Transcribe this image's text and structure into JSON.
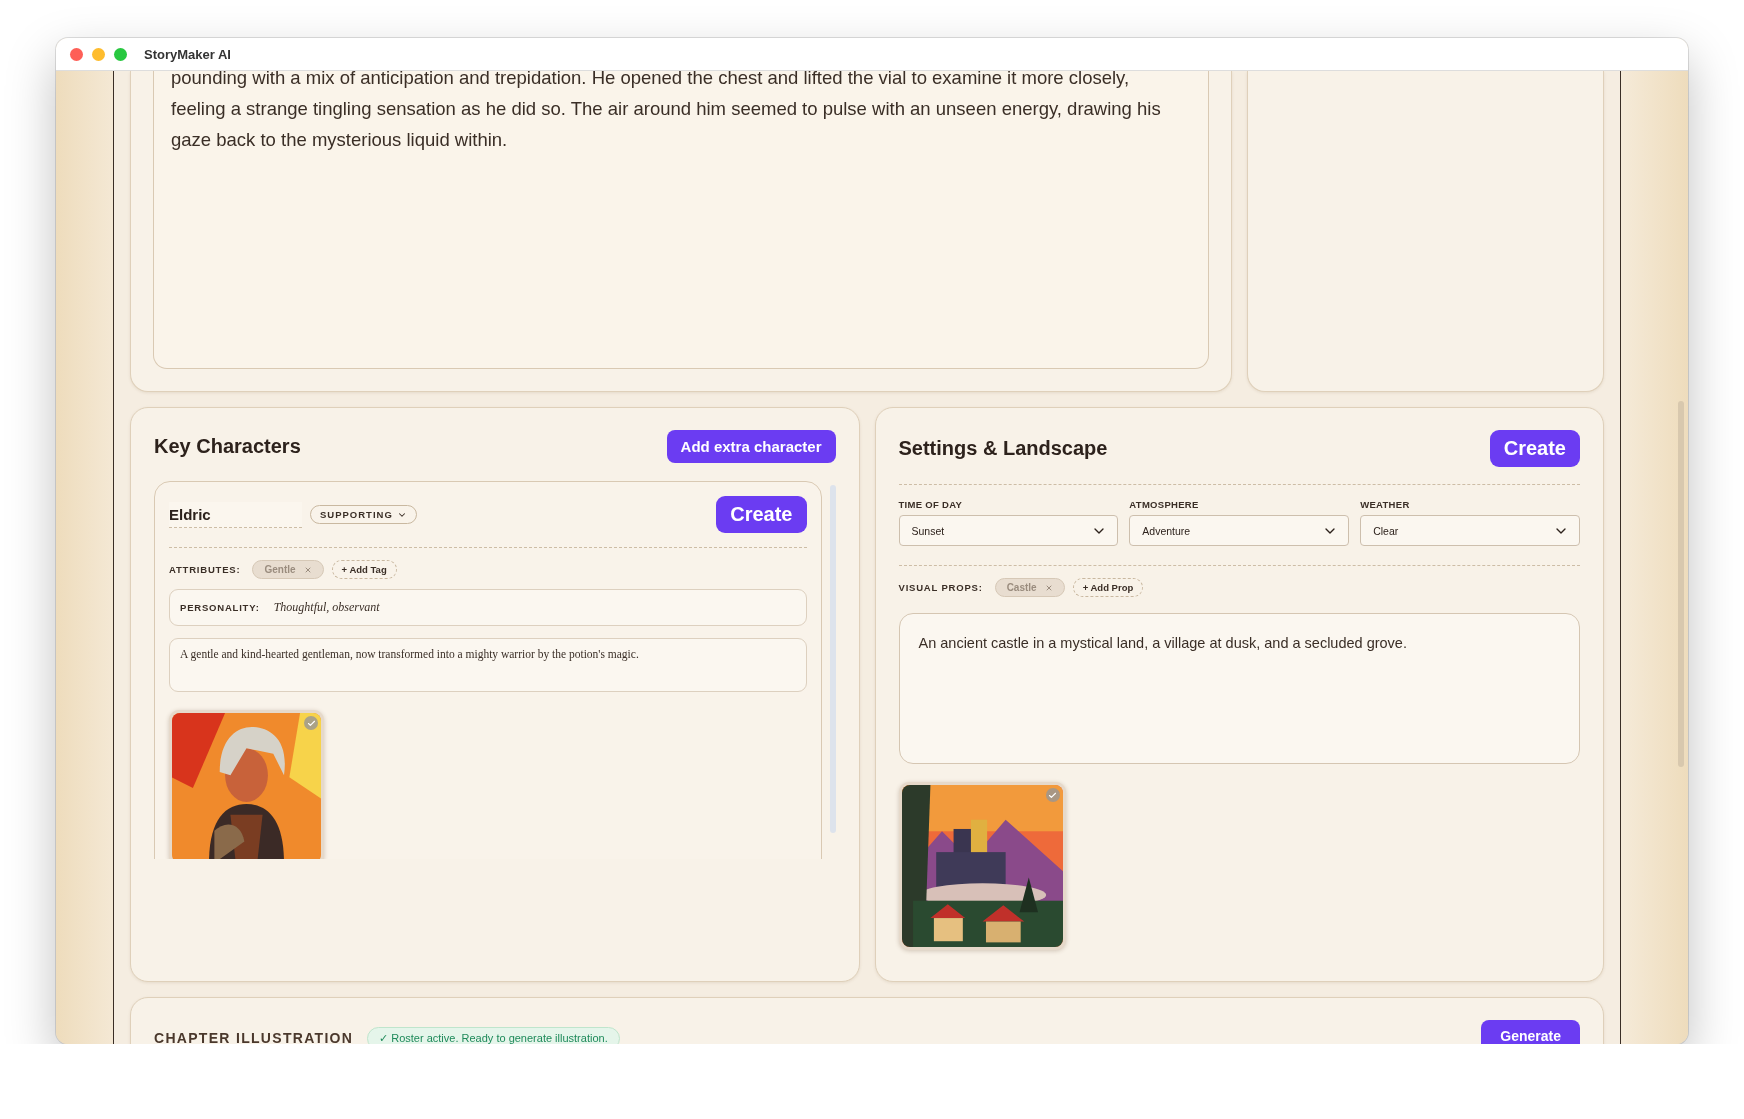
{
  "window": {
    "title": "StoryMaker AI"
  },
  "story": {
    "text": "pounding with a mix of anticipation and trepidation. He opened the chest and lifted the vial to examine it more closely, feeling a strange tingling sensation as he did so. The air around him seemed to pulse with an unseen energy, drawing his gaze back to the mysterious liquid within."
  },
  "key_characters": {
    "title": "Key Characters",
    "add_button": "Add extra character",
    "characters": [
      {
        "name": "Eldric",
        "role": "SUPPORTING",
        "create_button": "Create",
        "attributes_label": "ATTRIBUTES:",
        "attributes": [
          "Gentle"
        ],
        "add_tag": "+ Add Tag",
        "personality_label": "PERSONALITY:",
        "personality": "Thoughtful, observant",
        "description": "A gentle and kind-hearted gentleman, now transformed into a mighty warrior by the potion's magic.",
        "portrait": {
          "kind": "picture",
          "selected": true
        }
      }
    ]
  },
  "settings": {
    "title": "Settings & Landscape",
    "create_button": "Create",
    "selects": [
      {
        "label": "TIME OF DAY",
        "value": "Sunset"
      },
      {
        "label": "ATMOSPHERE",
        "value": "Adventure"
      },
      {
        "label": "WEATHER",
        "value": "Clear"
      }
    ],
    "props_label": "VISUAL PROPS:",
    "props": [
      "Castle"
    ],
    "add_prop": "+ Add Prop",
    "description": "An ancient castle in a mystical land, a village at dusk, and a secluded grove.",
    "image": {
      "kind": "picture",
      "selected": true
    }
  },
  "chapter_illustration": {
    "title": "CHAPTER ILLUSTRATION",
    "status": "✓ Roster active. Ready to generate illustration.",
    "generate_button": "Generate"
  }
}
